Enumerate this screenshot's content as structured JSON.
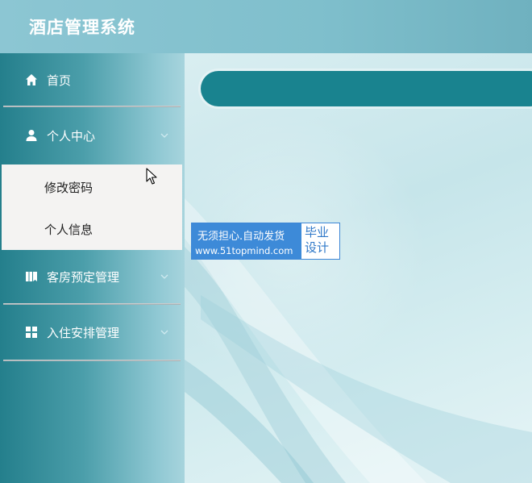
{
  "app": {
    "title": "酒店管理系统"
  },
  "sidebar": {
    "items": [
      {
        "label": "首页",
        "icon": "home-icon"
      },
      {
        "label": "个人中心",
        "icon": "user-icon",
        "expanded": true,
        "children": [
          {
            "label": "修改密码"
          },
          {
            "label": "个人信息"
          }
        ]
      },
      {
        "label": "客房预定管理",
        "icon": "book-icon"
      },
      {
        "label": "入住安排管理",
        "icon": "grid-icon"
      }
    ]
  },
  "watermark": {
    "line1": "无须担心.自动发货",
    "line2": "www.51topmind.com",
    "right_line1": "毕业",
    "right_line2": "设计"
  },
  "colors": {
    "header": "#7fbfcc",
    "sidebar_dark": "#247f8c",
    "panel": "#19838f",
    "submenu_bg": "#f4f3f2",
    "badge_blue": "#3d8ad8"
  }
}
